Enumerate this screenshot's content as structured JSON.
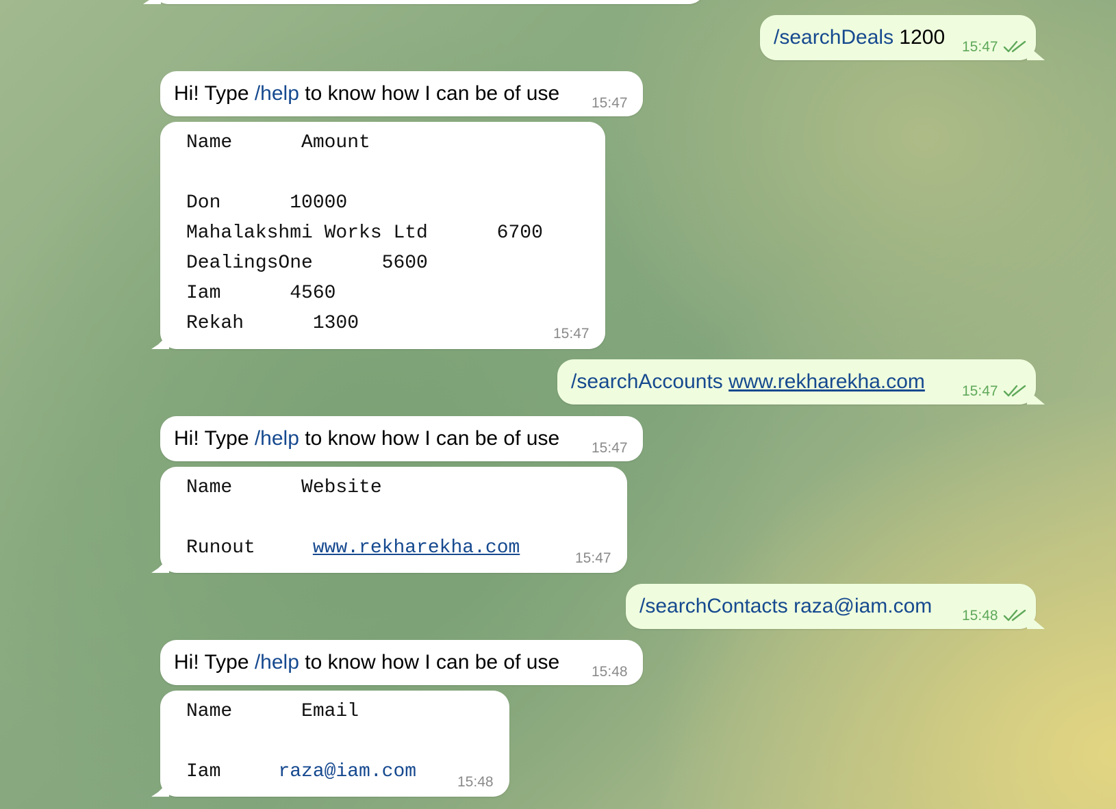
{
  "messages": {
    "m1": {
      "cmd": "/searchDeals",
      "arg": "1200",
      "time": "15:47"
    },
    "m2": {
      "prefix": "Hi! Type ",
      "cmd": "/help",
      "suffix": " to know how I can be of use",
      "time": "15:47"
    },
    "m3": {
      "header": "Name      Amount",
      "rows": [
        "Don      10000",
        "Mahalakshmi Works Ltd      6700",
        "DealingsOne      5600",
        "Iam      4560",
        "Rekah      1300"
      ],
      "time": "15:47"
    },
    "m4": {
      "cmd": "/searchAccounts",
      "link": "www.rekharekha.com",
      "time": "15:47"
    },
    "m5": {
      "prefix": "Hi! Type ",
      "cmd": "/help",
      "suffix": " to know how I can be of use",
      "time": "15:47"
    },
    "m6": {
      "header": "Name      Website",
      "row_name": "Runout",
      "row_link": "www.rekharekha.com",
      "time": "15:47"
    },
    "m7": {
      "cmd": "/searchContacts",
      "arg": "raza@iam.com",
      "time": "15:48"
    },
    "m8": {
      "prefix": "Hi! Type ",
      "cmd": "/help",
      "suffix": " to know how I can be of use",
      "time": "15:48"
    },
    "m9": {
      "header": "Name      Email",
      "row_name": "Iam",
      "row_email": "raza@iam.com",
      "time": "15:48"
    }
  },
  "icons": {
    "read_receipt": "double-check-icon"
  },
  "colors": {
    "outgoing_bubble": "#effdde",
    "incoming_bubble": "#ffffff",
    "command_link": "#16498f",
    "read_check": "#5fa85a"
  }
}
